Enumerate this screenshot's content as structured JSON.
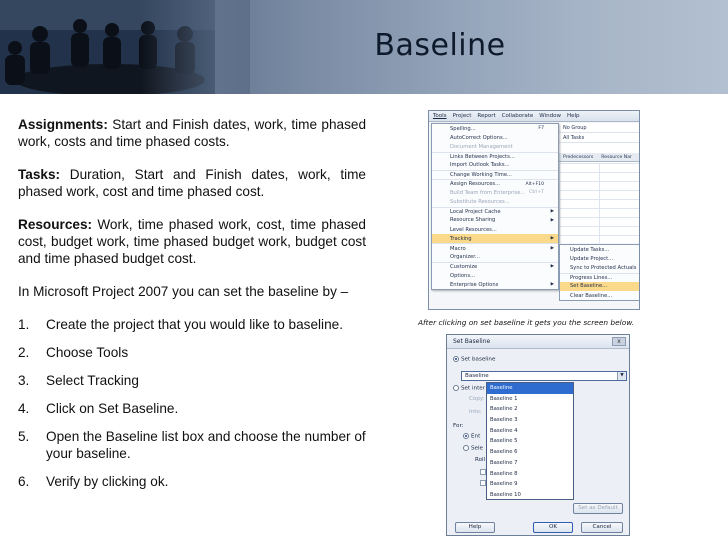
{
  "slide": {
    "title": "Baseline",
    "paragraphs": [
      {
        "label": "Assignments:",
        "text": " Start and Finish dates, work, time phased work, costs and time phased costs."
      },
      {
        "label": "Tasks:",
        "text": " Duration, Start and Finish dates, work, time phased work, cost and time phased cost."
      },
      {
        "label": "Resources:",
        "text": " Work, time phased work, cost, time phased cost, budget work, time phased budget work, budget cost and time phased budget cost."
      }
    ],
    "intro": "In Microsoft Project 2007 you can set the baseline by –",
    "steps": [
      {
        "num": "1.",
        "text": "Create the project that you would like to baseline."
      },
      {
        "num": "2.",
        "text": "Choose Tools"
      },
      {
        "num": "3.",
        "text": "Select Tracking"
      },
      {
        "num": "4.",
        "text": "Click on Set Baseline."
      },
      {
        "num": "5.",
        "text": "Open the Baseline list box and choose the number of your baseline."
      },
      {
        "num": "6.",
        "text": "Verify by clicking ok."
      }
    ],
    "caption": "After clicking on set baseline it gets you the screen below."
  },
  "tools_screenshot": {
    "menubar": [
      "Tools",
      "Project",
      "Report",
      "Collaborate",
      "Window",
      "Help"
    ],
    "menu_items": [
      {
        "label": "Spelling...",
        "shortcut": "F7"
      },
      {
        "label": "AutoCorrect Options..."
      },
      {
        "label": "Document Management",
        "dim": true
      },
      {
        "label": "Links Between Projects...",
        "sep": true
      },
      {
        "label": "Import Outlook Tasks..."
      },
      {
        "label": "Change Working Time...",
        "sep": true
      },
      {
        "label": "Assign Resources...",
        "shortcut": "Alt+F10",
        "sep": true
      },
      {
        "label": "Build Team from Enterprise...",
        "shortcut": "Ctrl+T",
        "dim": true
      },
      {
        "label": "Substitute Resources...",
        "dim": true
      },
      {
        "label": "Local Project Cache",
        "arrow": true,
        "sep": true
      },
      {
        "label": "Resource Sharing",
        "arrow": true
      },
      {
        "label": "Level Resources..."
      },
      {
        "label": "Tracking",
        "arrow": true,
        "highlight": true
      },
      {
        "label": "Macro",
        "arrow": true,
        "sep": true
      },
      {
        "label": "Organizer..."
      },
      {
        "label": "Customize",
        "arrow": true,
        "sep": true
      },
      {
        "label": "Options..."
      },
      {
        "label": "Enterprise Options",
        "arrow": true
      }
    ],
    "submenu_items": [
      {
        "label": "Update Tasks..."
      },
      {
        "label": "Update Project..."
      },
      {
        "label": "Sync to Protected Actuals"
      },
      {
        "label": "Progress Lines...",
        "sep": true
      },
      {
        "label": "Set Baseline...",
        "highlight": true
      },
      {
        "label": "Clear Baseline..."
      }
    ],
    "grid": {
      "group_label": "No Group",
      "filter_label": "All Tasks",
      "col1": "Predecessors",
      "col2": "Resource Nar"
    }
  },
  "dialog_screenshot": {
    "title": "Set Baseline",
    "close": "x",
    "set_baseline_label": "Set baseline",
    "combo_value": "Baseline",
    "set_interim_label": "Set inter",
    "copy_label": "Copy:",
    "into_label": "Into:",
    "for_label": "For:",
    "entire_label": "Ent",
    "selected_label": "Sele",
    "roll_label": "Roll",
    "options": [
      "Baseline",
      "Baseline 1",
      "Baseline 2",
      "Baseline 3",
      "Baseline 4",
      "Baseline 5",
      "Baseline 6",
      "Baseline 7",
      "Baseline 8",
      "Baseline 9",
      "Baseline 10"
    ],
    "set_default": "Set as Default",
    "help": "Help",
    "ok": "OK",
    "cancel": "Cancel"
  }
}
